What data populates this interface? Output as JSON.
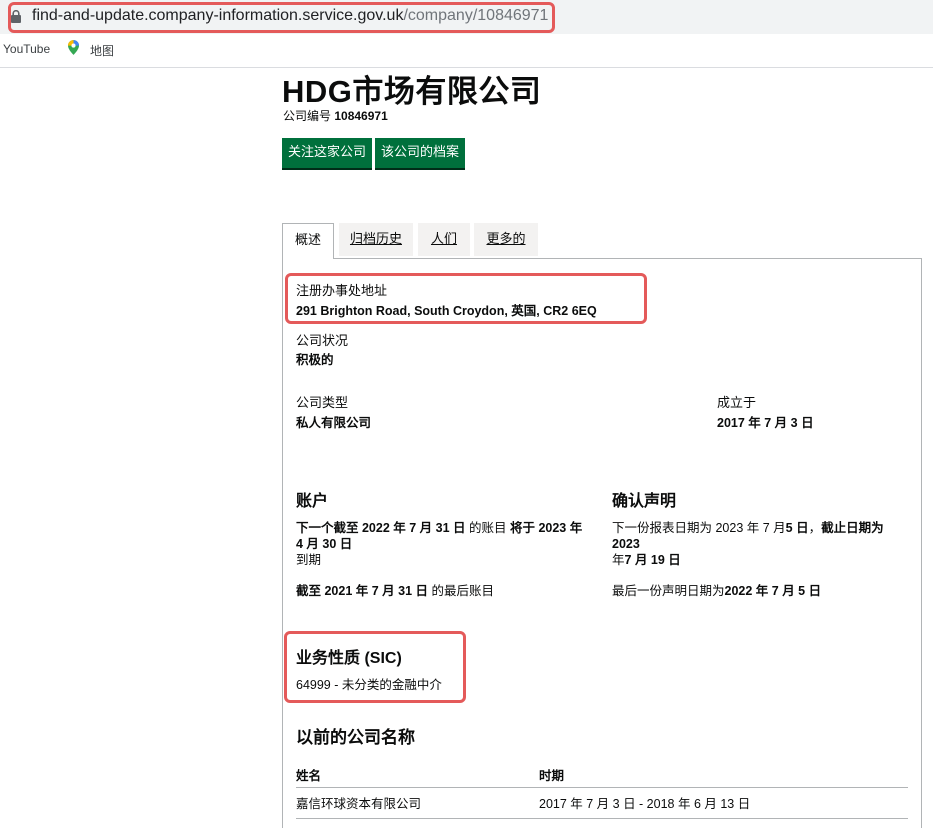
{
  "browser": {
    "url_domain": "find-and-update.company-information.service.gov.uk",
    "url_path": "/company/10846971",
    "bookmarks": [
      "YouTube",
      "地图"
    ]
  },
  "company": {
    "name": "HDG市场有限公司",
    "number_label": "公司编号",
    "number": "10846971"
  },
  "buttons": {
    "follow": "关注这家公司",
    "file": "该公司的档案"
  },
  "tabs": [
    "概述",
    "归档历史",
    "人们",
    "更多的"
  ],
  "overview": {
    "registered_office_label": "注册办事处地址",
    "registered_office": "291 Brighton Road, South Croydon, 英国, CR2 6EQ",
    "status_label": "公司状况",
    "status": "积极的",
    "type_label": "公司类型",
    "type": "私人有限公司",
    "incorporated_label": "成立于",
    "incorporated": "2017 年 7 月 3 日"
  },
  "accounts": {
    "heading": "账户",
    "next_prefix": "下一个截至 2022 年 7 月 31 日",
    "next_middle": " 的账目 ",
    "next_due": "将于 2023 年 4 月 30 日",
    "next_suffix": "到期",
    "last_bold": "截至 2021 年 7 月 31 日",
    "last_suffix": " 的最后账目"
  },
  "confirmation": {
    "heading": "确认声明",
    "next_a": "下一份报表日期为 2023 年 7 月",
    "next_b": "5 日",
    "next_c": "，",
    "next_d": "截止日期为 2023",
    "next_e": "年",
    "next_f": "7 月 19 日",
    "last_prefix": "最后一份声明日期为",
    "last_bold": "2022 年 7 月 5 日"
  },
  "sic": {
    "heading": "业务性质 (SIC)",
    "code": "64999 - 未分类的金融中介"
  },
  "previous_names": {
    "heading": "以前的公司名称",
    "col_name": "姓名",
    "col_period": "时期",
    "rows": [
      {
        "name": "嘉信环球资本有限公司",
        "period": "2017 年 7 月 3 日 - 2018 年 6 月 13 日"
      }
    ]
  },
  "colors": {
    "button_green": "#00703c",
    "highlight": "#e45a5a"
  }
}
